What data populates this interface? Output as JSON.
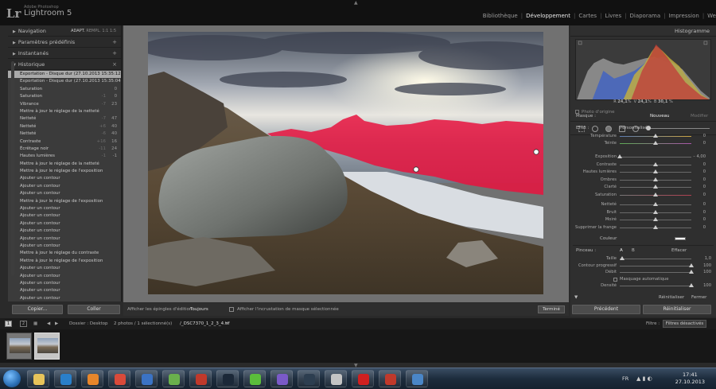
{
  "topbar": {
    "logo": "Lr",
    "brand_small": "Adobe Photoshop",
    "brand_name": "Lightroom 5",
    "modules": [
      "Bibliothèque",
      "Développement",
      "Cartes",
      "Livres",
      "Diaporama",
      "Impression",
      "We"
    ],
    "active_module": "Développement"
  },
  "left": {
    "navigator": {
      "label": "Navigation",
      "opts": [
        "ADAPT.",
        "REMPL.",
        "1:1",
        "1:5"
      ]
    },
    "presets": {
      "label": "Paramètres prédéfinis"
    },
    "snapshots": {
      "label": "Instantanés"
    },
    "history": {
      "label": "Historique",
      "rows": [
        {
          "name": "Exportation - Disque dur (27.10.2013 15:35:12)",
          "v1": "",
          "v2": "",
          "selected": true
        },
        {
          "name": "Exportation - Disque dur (27.10.2013 15:35:04)",
          "v1": "",
          "v2": ""
        },
        {
          "name": "Saturation",
          "v1": "",
          "v2": "0"
        },
        {
          "name": "Saturation",
          "v1": "-1",
          "v2": "0"
        },
        {
          "name": "Vibrance",
          "v1": "-7",
          "v2": "23"
        },
        {
          "name": "Mettre à jour le réglage de la netteté",
          "v1": "",
          "v2": ""
        },
        {
          "name": "Netteté",
          "v1": "-7",
          "v2": "47"
        },
        {
          "name": "Netteté",
          "v1": "+6",
          "v2": "40"
        },
        {
          "name": "Netteté",
          "v1": "-6",
          "v2": "40"
        },
        {
          "name": "Contraste",
          "v1": "+16",
          "v2": "16"
        },
        {
          "name": "Écrêtage noir",
          "v1": "-11",
          "v2": "24"
        },
        {
          "name": "Hautes lumières",
          "v1": "-1",
          "v2": "-1"
        },
        {
          "name": "Mettre à jour le réglage de la netteté",
          "v1": "",
          "v2": ""
        },
        {
          "name": "Mettre à jour le réglage de l'exposition",
          "v1": "",
          "v2": ""
        },
        {
          "name": "Ajouter un contour",
          "v1": "",
          "v2": ""
        },
        {
          "name": "Ajouter un contour",
          "v1": "",
          "v2": ""
        },
        {
          "name": "Ajouter un contour",
          "v1": "",
          "v2": ""
        },
        {
          "name": "Mettre à jour le réglage de l'exposition",
          "v1": "",
          "v2": ""
        },
        {
          "name": "Ajouter un contour",
          "v1": "",
          "v2": ""
        },
        {
          "name": "Ajouter un contour",
          "v1": "",
          "v2": ""
        },
        {
          "name": "Ajouter un contour",
          "v1": "",
          "v2": ""
        },
        {
          "name": "Ajouter un contour",
          "v1": "",
          "v2": ""
        },
        {
          "name": "Ajouter un contour",
          "v1": "",
          "v2": ""
        },
        {
          "name": "Ajouter un contour",
          "v1": "",
          "v2": ""
        },
        {
          "name": "Mettre à jour le réglage du contraste",
          "v1": "",
          "v2": ""
        },
        {
          "name": "Mettre à jour le réglage de l'exposition",
          "v1": "",
          "v2": ""
        },
        {
          "name": "Ajouter un contour",
          "v1": "",
          "v2": ""
        },
        {
          "name": "Ajouter un contour",
          "v1": "",
          "v2": ""
        },
        {
          "name": "Ajouter un contour",
          "v1": "",
          "v2": ""
        },
        {
          "name": "Ajouter un contour",
          "v1": "",
          "v2": ""
        },
        {
          "name": "Ajouter un contour",
          "v1": "",
          "v2": ""
        }
      ]
    },
    "copy_btn": "Copier...",
    "paste_btn": "Coller"
  },
  "center_toolbar": {
    "pins_label": "Afficher les épingles d'édition :",
    "pins_value": "Toujours",
    "overlay_label": "Afficher l'incrustation de masque sélectionnée",
    "done_btn": "Terminé"
  },
  "right": {
    "histogram_label": "Histogramme",
    "rgb": {
      "r_label": "R",
      "r": "24,1",
      "g_label": "V",
      "g": "24,1",
      "b_label": "B",
      "b": "30,1",
      "unit": "%"
    },
    "original_photo": "Photo d'origine",
    "mask_label": "Masque :",
    "mask_new": "Nouveau",
    "mask_modify": "Modifier",
    "effect_label": "Effet :",
    "effect_value": "Personnalisé",
    "sliders1": [
      {
        "name": "Température",
        "val": "0",
        "pos": 0.5,
        "track": "warm"
      },
      {
        "name": "Teinte",
        "val": "0",
        "pos": 0.5,
        "track": "tint"
      }
    ],
    "sliders2": [
      {
        "name": "Exposition",
        "val": "– 4,00",
        "pos": 0.0,
        "track": ""
      },
      {
        "name": "Contraste",
        "val": "0",
        "pos": 0.5,
        "track": ""
      },
      {
        "name": "Hautes lumières",
        "val": "0",
        "pos": 0.5,
        "track": ""
      },
      {
        "name": "Ombres",
        "val": "0",
        "pos": 0.5,
        "track": ""
      },
      {
        "name": "Clarté",
        "val": "0",
        "pos": 0.5,
        "track": ""
      },
      {
        "name": "Saturation",
        "val": "0",
        "pos": 0.5,
        "track": "sat"
      }
    ],
    "sliders3": [
      {
        "name": "Netteté",
        "val": "0",
        "pos": 0.5,
        "track": ""
      },
      {
        "name": "Bruit",
        "val": "0",
        "pos": 0.5,
        "track": ""
      },
      {
        "name": "Moiré",
        "val": "0",
        "pos": 0.5,
        "track": ""
      },
      {
        "name": "Supprimer la frange",
        "val": "0",
        "pos": 0.5,
        "track": ""
      }
    ],
    "color_label": "Couleur",
    "brush_label": "Pinceau :",
    "brush_a": "A",
    "brush_b": "B",
    "brush_erase": "Effacer",
    "brush": [
      {
        "name": "Taille",
        "val": "1,0"
      },
      {
        "name": "Contour progressif",
        "val": "100"
      },
      {
        "name": "Débit",
        "val": "100"
      },
      {
        "name": "Masquage automatique",
        "val": ""
      },
      {
        "name": "Densité",
        "val": "100"
      }
    ],
    "reset_btn": "Réinitialiser",
    "close_btn": "Fermer",
    "prev_btn": "Précédent",
    "reset_main_btn": "Réinitialiser"
  },
  "filmbar": {
    "box1": "1",
    "box2": "2",
    "folder": "Dossier : Desktop",
    "count": "2 photos / 1 sélectionné(s)",
    "file": "/_DSC7370_1_2_3_4.tif",
    "filter_label": "Filtre :",
    "filter_value": "Filtres désactivés"
  },
  "taskbar": {
    "icons": [
      "explorer",
      "blurb",
      "media-player",
      "chrome",
      "thunderbird",
      "colors",
      "filezilla",
      "steam",
      "orbit",
      "photo-app",
      "lightroom",
      "image-viewer",
      "iloloc",
      "filezilla-2",
      "window"
    ],
    "lang": "FR",
    "time": "17:41",
    "date": "27.10.2013"
  }
}
